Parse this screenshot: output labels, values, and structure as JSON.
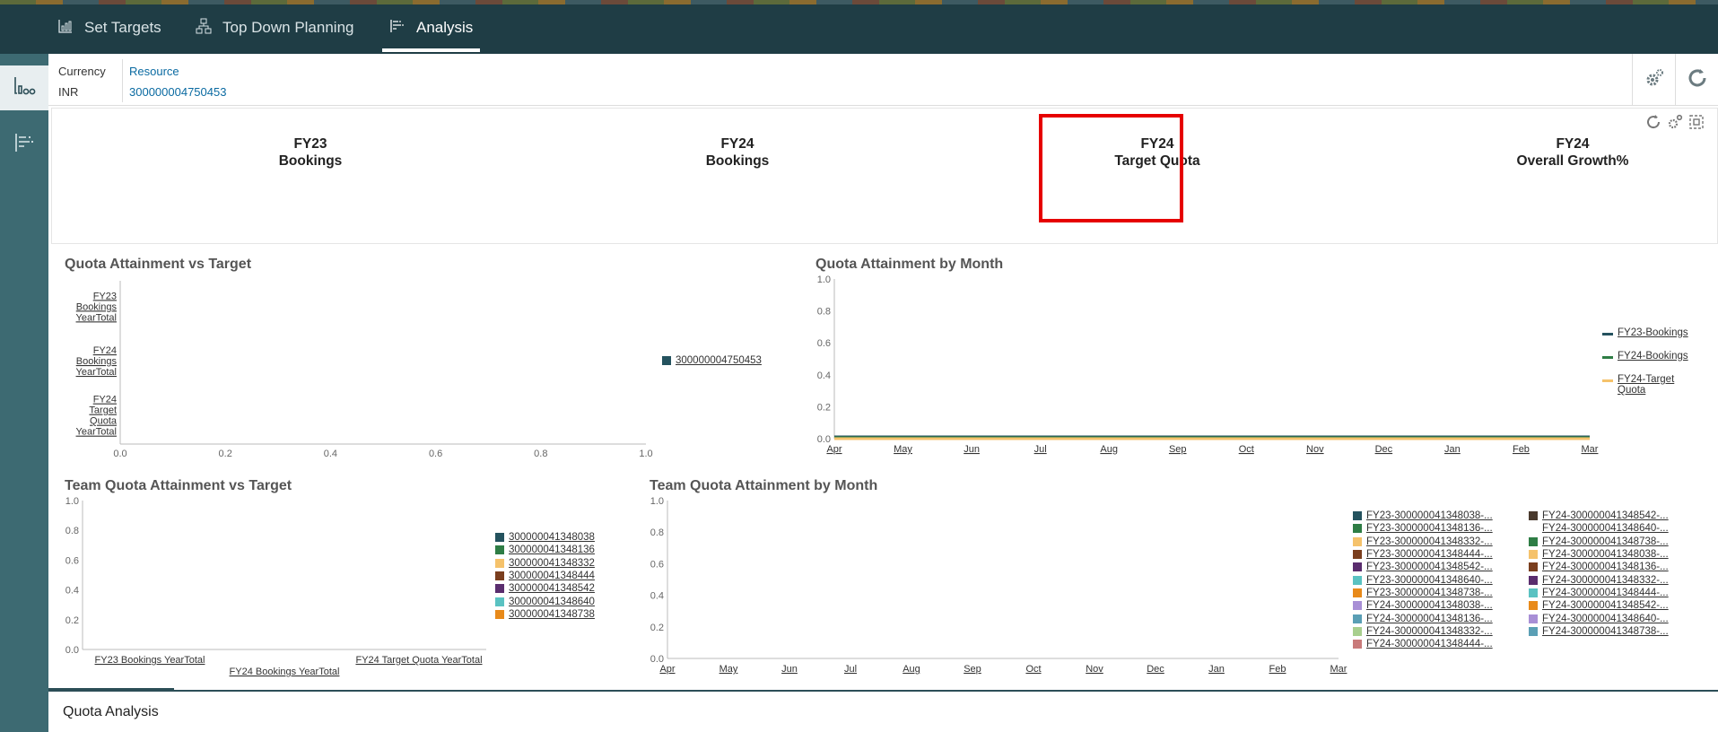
{
  "nav": {
    "tabs": [
      {
        "label": "Set Targets",
        "icon": "bar-chart-icon"
      },
      {
        "label": "Top Down Planning",
        "icon": "hierarchy-icon"
      },
      {
        "label": "Analysis",
        "icon": "analysis-icon",
        "active": true
      }
    ]
  },
  "rail": {
    "items": [
      {
        "icon": "dashboard-icon",
        "active": true
      },
      {
        "icon": "list-tree-icon",
        "active": false
      }
    ]
  },
  "pov": {
    "currency_label": "Currency",
    "currency_value": "INR",
    "resource_label": "Resource",
    "resource_value": "300000004750453"
  },
  "kpis": [
    {
      "year": "FY23",
      "label": "Bookings"
    },
    {
      "year": "FY24",
      "label": "Bookings"
    },
    {
      "year": "FY24",
      "label": "Target Quota"
    },
    {
      "year": "FY24",
      "label": "Overall Growth%"
    }
  ],
  "chart_data": [
    {
      "type": "bar",
      "title": "Quota Attainment vs Target",
      "orientation": "horizontal",
      "categories": [
        "FY23 Bookings YearTotal",
        "FY24 Bookings YearTotal",
        "FY24 Target Quota YearTotal"
      ],
      "series": [
        {
          "name": "300000004750453",
          "values": [
            0,
            0,
            0
          ]
        }
      ],
      "xlim": [
        0.0,
        1.0
      ],
      "xticks": [
        "0.0",
        "0.2",
        "0.4",
        "0.6",
        "0.8",
        "1.0"
      ],
      "legend": "right",
      "colors": [
        "#24525e"
      ]
    },
    {
      "type": "line",
      "title": "Quota Attainment by Month",
      "categories": [
        "Apr",
        "May",
        "Jun",
        "Jul",
        "Aug",
        "Sep",
        "Oct",
        "Nov",
        "Dec",
        "Jan",
        "Feb",
        "Mar"
      ],
      "series": [
        {
          "name": "FY23-Bookings",
          "values": [
            0,
            0,
            0,
            0,
            0,
            0,
            0,
            0,
            0,
            0,
            0,
            0
          ]
        },
        {
          "name": "FY24-Bookings",
          "values": [
            0,
            0,
            0,
            0,
            0,
            0,
            0,
            0,
            0,
            0,
            0,
            0
          ]
        },
        {
          "name": "FY24-Target Quota",
          "values": [
            0,
            0,
            0,
            0,
            0,
            0,
            0,
            0,
            0,
            0,
            0,
            0
          ]
        }
      ],
      "ylim": [
        0.0,
        1.0
      ],
      "yticks": [
        "0.0",
        "0.2",
        "0.4",
        "0.6",
        "0.8",
        "1.0"
      ],
      "legend": "right",
      "colors": [
        "#24525e",
        "#2e7d45",
        "#f5c26b"
      ]
    },
    {
      "type": "bar",
      "title": "Team Quota Attainment vs Target",
      "categories": [
        "FY23 Bookings YearTotal",
        "FY24 Bookings YearTotal",
        "FY24 Target Quota YearTotal"
      ],
      "series": [
        {
          "name": "300000041348038",
          "values": [
            0,
            0,
            0
          ]
        },
        {
          "name": "300000041348136",
          "values": [
            0,
            0,
            0
          ]
        },
        {
          "name": "300000041348332",
          "values": [
            0,
            0,
            0
          ]
        },
        {
          "name": "300000041348444",
          "values": [
            0,
            0,
            0
          ]
        },
        {
          "name": "300000041348542",
          "values": [
            0,
            0,
            0
          ]
        },
        {
          "name": "300000041348640",
          "values": [
            0,
            0,
            0
          ]
        },
        {
          "name": "300000041348738",
          "values": [
            0,
            0,
            0
          ]
        }
      ],
      "ylim": [
        0.0,
        1.0
      ],
      "yticks": [
        "0.0",
        "0.2",
        "0.4",
        "0.6",
        "0.8",
        "1.0"
      ],
      "legend": "right",
      "colors": [
        "#24525e",
        "#2e7d45",
        "#f5c26b",
        "#7a3e1e",
        "#5a2d6e",
        "#5ac2c2",
        "#e88a1a"
      ]
    },
    {
      "type": "line",
      "title": "Team Quota Attainment by Month",
      "categories": [
        "Apr",
        "May",
        "Jun",
        "Jul",
        "Aug",
        "Sep",
        "Oct",
        "Nov",
        "Dec",
        "Jan",
        "Feb",
        "Mar"
      ],
      "series": [
        {
          "name": "FY23-300000041348038-..."
        },
        {
          "name": "FY23-300000041348136-..."
        },
        {
          "name": "FY23-300000041348332-..."
        },
        {
          "name": "FY23-300000041348444-..."
        },
        {
          "name": "FY23-300000041348542-..."
        },
        {
          "name": "FY23-300000041348640-..."
        },
        {
          "name": "FY23-300000041348738-..."
        },
        {
          "name": "FY24-300000041348038-..."
        },
        {
          "name": "FY24-300000041348136-..."
        },
        {
          "name": "FY24-300000041348332-..."
        },
        {
          "name": "FY24-300000041348444-..."
        },
        {
          "name": "FY24-300000041348542-..."
        },
        {
          "name": "FY24-300000041348640-..."
        },
        {
          "name": "FY24-300000041348738-..."
        },
        {
          "name": "FY24-300000041348038-..."
        },
        {
          "name": "FY24-300000041348136-..."
        },
        {
          "name": "FY24-300000041348332-..."
        },
        {
          "name": "FY24-300000041348444-..."
        },
        {
          "name": "FY24-300000041348542-..."
        },
        {
          "name": "FY24-300000041348640-..."
        },
        {
          "name": "FY24-300000041348738-..."
        }
      ],
      "ylim": [
        0.0,
        1.0
      ],
      "yticks": [
        "0.0",
        "0.2",
        "0.4",
        "0.6",
        "0.8",
        "1.0"
      ],
      "legend": "right",
      "colors": [
        "#24525e",
        "#2e7d45",
        "#f5c26b",
        "#7a3e1e",
        "#5a2d6e",
        "#5ac2c2",
        "#e88a1a",
        "#a88fd6",
        "#5a9fb5",
        "#a8cf8e",
        "#c97a7a",
        "#4a3a2e",
        "#ffffff",
        "#2e7d45",
        "#f5c26b",
        "#7a3e1e",
        "#5a2d6e",
        "#5ac2c2",
        "#e88a1a",
        "#a88fd6",
        "#5a9fb5"
      ]
    }
  ],
  "footer": {
    "tab_label": "Quota Analysis"
  }
}
